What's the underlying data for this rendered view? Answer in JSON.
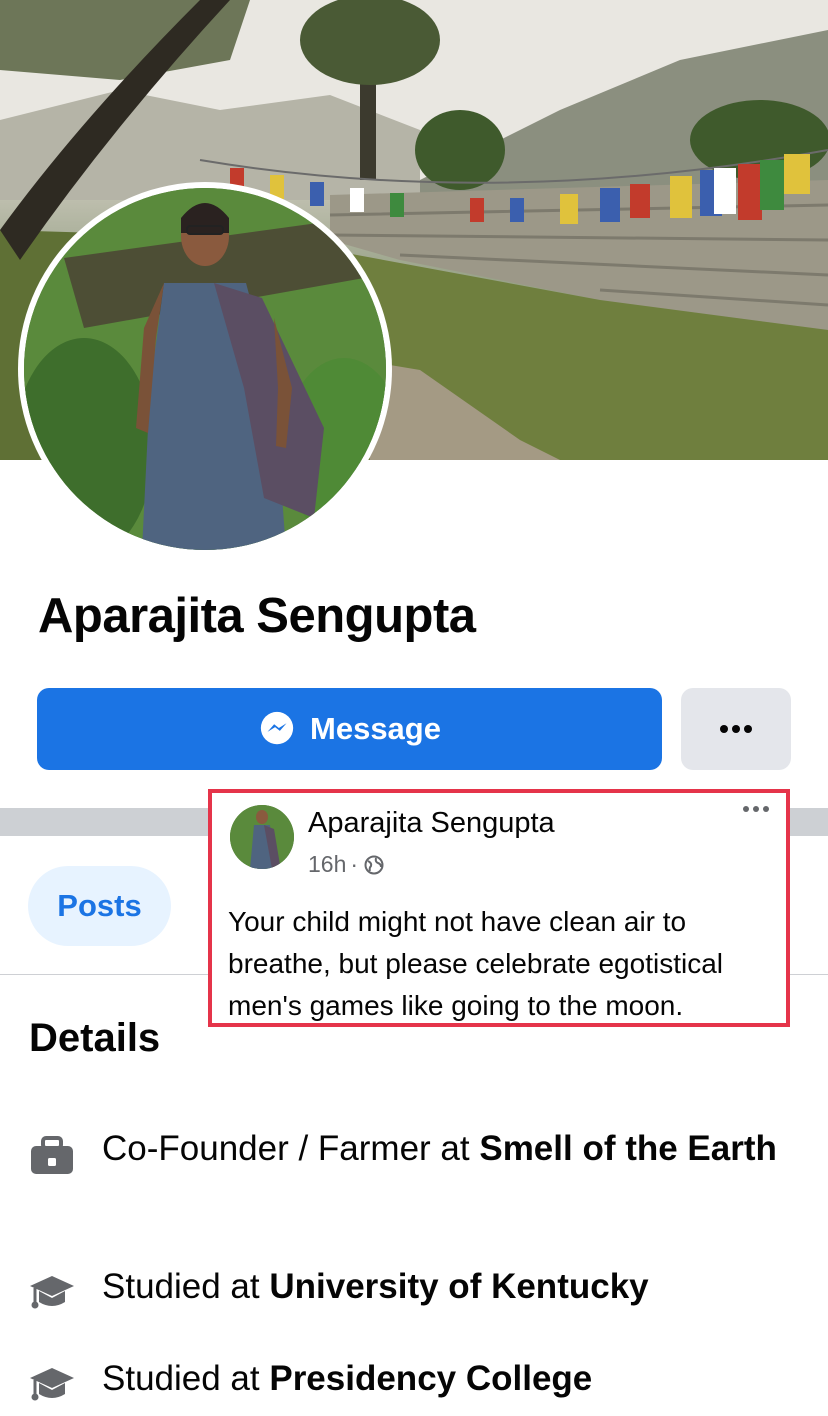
{
  "profile": {
    "name": "Aparajita Sengupta",
    "message_label": "Message",
    "more_label": "..."
  },
  "tabs": [
    {
      "label": "Posts",
      "active": true
    }
  ],
  "details": {
    "title": "Details",
    "items": [
      {
        "icon": "briefcase-icon",
        "prefix": "Co-Founder / Farmer at ",
        "bold": "Smell of the Earth"
      },
      {
        "icon": "graduation-cap-icon",
        "prefix": "Studied at ",
        "bold": "University of Kentucky"
      },
      {
        "icon": "graduation-cap-icon",
        "prefix": "Studied at ",
        "bold": "Presidency College"
      }
    ]
  },
  "post": {
    "author": "Aparajita Sengupta",
    "time": "16h",
    "separator": "·",
    "privacy_icon": "globe-icon",
    "text": "Your child might not have clean air to breathe, but please celebrate egotistical men's games like going to the moon."
  },
  "colors": {
    "accent": "#1b74e4",
    "highlight_border": "#e5344a"
  }
}
